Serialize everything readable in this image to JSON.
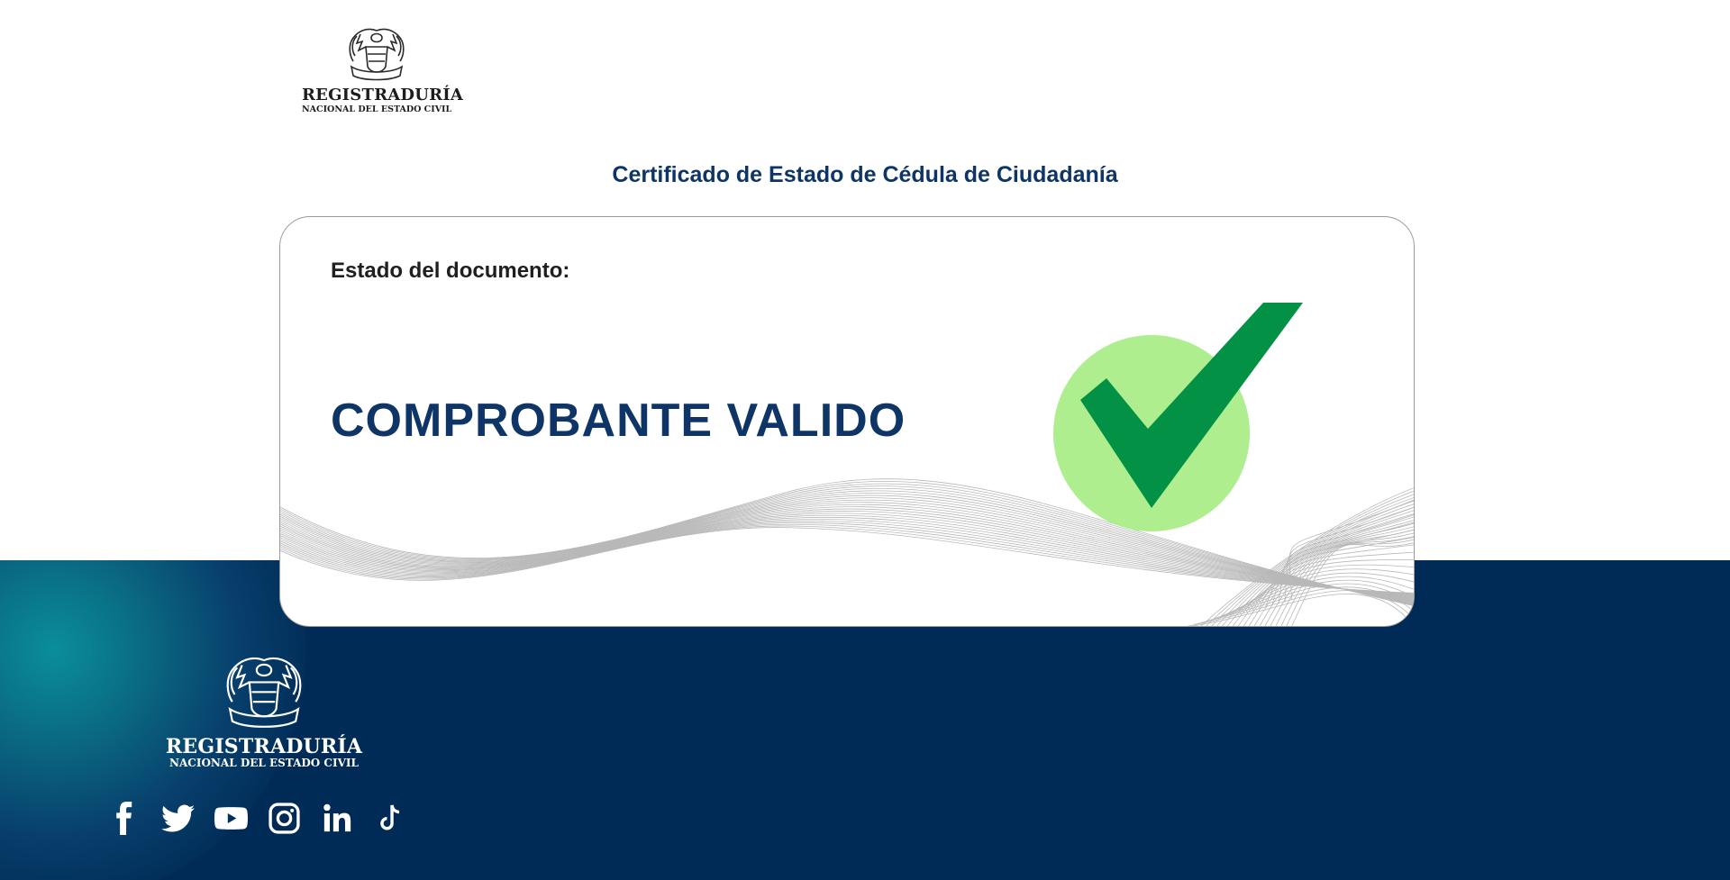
{
  "header": {
    "logo": {
      "name": "REGISTRADURÍA",
      "subtitle": "NACIONAL DEL ESTADO CIVIL"
    }
  },
  "page_title": "Certificado de Estado de Cédula de Ciudadanía",
  "card": {
    "label": "Estado del documento:",
    "status": "COMPROBANTE VALIDO",
    "icon": "check-valid-icon",
    "colors": {
      "check": "#039245",
      "circle": "#aeee8f"
    }
  },
  "footer": {
    "logo": {
      "name": "REGISTRADURÍA",
      "subtitle": "NACIONAL DEL ESTADO CIVIL"
    },
    "social": [
      "facebook-icon",
      "twitter-icon",
      "youtube-icon",
      "instagram-icon",
      "linkedin-icon",
      "tiktok-icon"
    ],
    "colors": {
      "background": "#002b56",
      "accent": "#0a8e9b"
    }
  },
  "colors": {
    "title": "#0e3566"
  }
}
